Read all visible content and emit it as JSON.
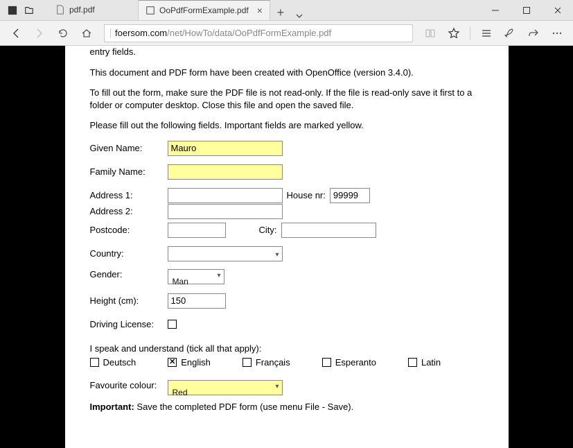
{
  "window": {
    "tabs": [
      {
        "label": "pdf.pdf"
      },
      {
        "label": "OoPdfFormExample.pdf"
      }
    ],
    "active_tab": 1,
    "url_host": "foersom.com",
    "url_path": "/net/HowTo/data/OoPdfFormExample.pdf"
  },
  "doc": {
    "trunc_top": "entry fields.",
    "p1": "This document and PDF form have been created with OpenOffice (version 3.4.0).",
    "p2": "To fill out the form, make sure the PDF file is not read-only. If the file is read-only save it first to a folder or computer desktop. Close this file and open the saved file.",
    "p3": "Please fill out the following fields. Important fields are marked yellow.",
    "labels": {
      "given": "Given Name:",
      "family": "Family Name:",
      "addr1": "Address 1:",
      "addr2": "Address 2:",
      "house": "House nr:",
      "postcode": "Postcode:",
      "city": "City:",
      "country": "Country:",
      "gender": "Gender:",
      "height": "Height (cm):",
      "driving": "Driving License:",
      "languages_q": "I speak and understand (tick all that apply):",
      "favcolor": "Favourite colour:"
    },
    "values": {
      "given": "Mauro",
      "family": "",
      "addr1": "",
      "addr2": "",
      "house": "99999",
      "postcode": "",
      "city": "",
      "country": "",
      "gender": "Man",
      "height": "150",
      "driving_checked": false,
      "favcolor": "Red",
      "lang_english_checked": true
    },
    "languages": {
      "de": "Deutsch",
      "en": "English",
      "fr": "Français",
      "eo": "Esperanto",
      "la": "Latin"
    },
    "important_label": "Important:",
    "important_text": " Save the completed PDF form (use menu File - Save)."
  }
}
